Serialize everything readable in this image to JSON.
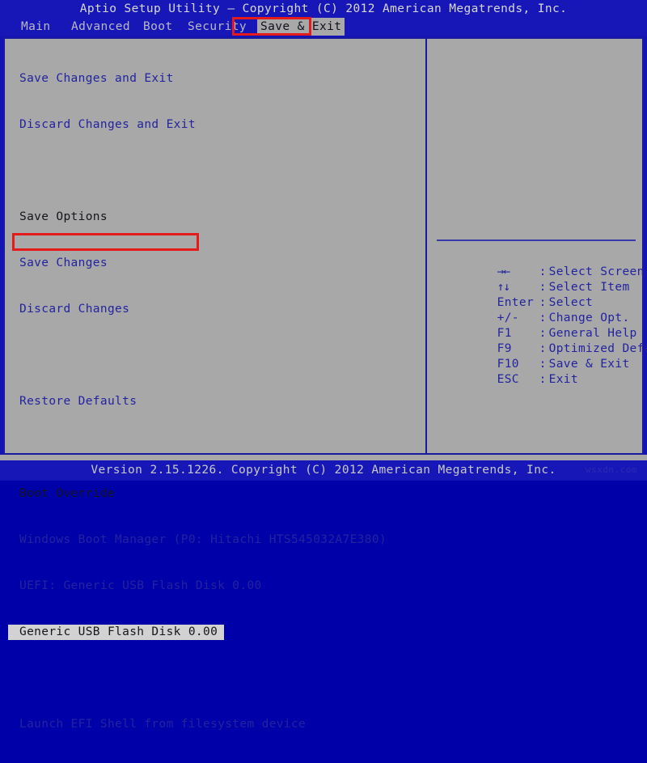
{
  "window": {
    "title": "Aptio Setup Utility – Copyright (C) 2012 American Megatrends, Inc."
  },
  "menubar": {
    "items": [
      {
        "label": "Main",
        "active": false
      },
      {
        "label": "Advanced",
        "active": false
      },
      {
        "label": "Boot",
        "active": false
      },
      {
        "label": "Security",
        "active": false
      },
      {
        "label": "Save & Exit",
        "active": true
      }
    ]
  },
  "annotations": [
    {
      "name": "save-exit-tab-highlight",
      "color": "#e51b1b"
    },
    {
      "name": "selected-boot-entry-highlight",
      "color": "#e51b1b"
    }
  ],
  "main": {
    "rows": [
      {
        "text": "Save Changes and Exit",
        "type": "item"
      },
      {
        "text": "Discard Changes and Exit",
        "type": "item"
      },
      {
        "text": "",
        "type": "spacer"
      },
      {
        "text": "Save Options",
        "type": "header"
      },
      {
        "text": "Save Changes",
        "type": "item"
      },
      {
        "text": "Discard Changes",
        "type": "item"
      },
      {
        "text": "",
        "type": "spacer"
      },
      {
        "text": "Restore Defaults",
        "type": "item"
      },
      {
        "text": "",
        "type": "spacer"
      },
      {
        "text": "Boot Override",
        "type": "header"
      },
      {
        "text": "Windows Boot Manager (P0: Hitachi HTS545032A7E380)",
        "type": "item"
      },
      {
        "text": "UEFI: Generic USB Flash Disk 0.00",
        "type": "item"
      },
      {
        "text": "Generic USB Flash Disk 0.00",
        "type": "selected"
      },
      {
        "text": "",
        "type": "spacer"
      },
      {
        "text": "Launch EFI Shell from filesystem device",
        "type": "item"
      }
    ]
  },
  "help": {
    "keys": [
      {
        "key": "→←",
        "sep": ":",
        "action": "Select Screen"
      },
      {
        "key": "↑↓",
        "sep": ":",
        "action": "Select Item"
      },
      {
        "key": "Enter",
        "sep": ":",
        "action": "Select"
      },
      {
        "key": "+/-",
        "sep": ":",
        "action": "Change Opt."
      },
      {
        "key": "F1",
        "sep": ":",
        "action": "General Help"
      },
      {
        "key": "F9",
        "sep": ":",
        "action": "Optimized Defaults"
      },
      {
        "key": "F10",
        "sep": ":",
        "action": "Save & Exit"
      },
      {
        "key": "ESC",
        "sep": ":",
        "action": "Exit"
      }
    ]
  },
  "footer": {
    "version_text": "Version 2.15.1226. Copyright (C) 2012 American Megatrends, Inc.",
    "watermark": "wsxdn.com"
  },
  "colors": {
    "background_blue": "#1717b8",
    "panel_gray": "#a8a8a8",
    "item_blue": "#2323a0",
    "header_dark": "#15151c",
    "selection_gray": "#d2d2d2",
    "annotation_red": "#e51b1b",
    "border_blue": "#1a1a9e"
  }
}
